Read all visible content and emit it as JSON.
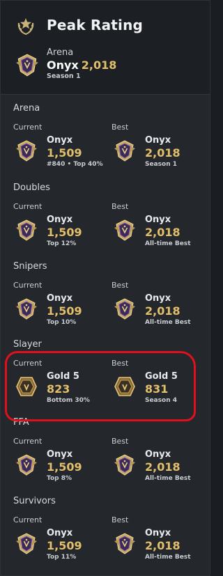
{
  "header": {
    "title": "Peak Rating",
    "icon": "laurel-star-icon",
    "peak": {
      "playlist": "Arena",
      "tier": "Onyx",
      "value": "2,018",
      "season": "Season 1",
      "icon": "onyx-rank-icon"
    }
  },
  "labels": {
    "current": "Current",
    "best": "Best"
  },
  "sections": [
    {
      "title": "Arena",
      "current": {
        "tier": "Onyx",
        "value": "1,509",
        "sub": "#840 • Top 40%",
        "icon": "onyx-rank-icon"
      },
      "best": {
        "tier": "Onyx",
        "value": "2,018",
        "sub": "Season 1",
        "icon": "onyx-rank-icon"
      }
    },
    {
      "title": "Doubles",
      "current": {
        "tier": "Onyx",
        "value": "1,509",
        "sub": "Top 12%",
        "icon": "onyx-rank-icon"
      },
      "best": {
        "tier": "Onyx",
        "value": "2,018",
        "sub": "All-time Best",
        "icon": "onyx-rank-icon"
      }
    },
    {
      "title": "Snipers",
      "current": {
        "tier": "Onyx",
        "value": "1,509",
        "sub": "Top 10%",
        "icon": "onyx-rank-icon"
      },
      "best": {
        "tier": "Onyx",
        "value": "2,018",
        "sub": "All-time Best",
        "icon": "onyx-rank-icon"
      }
    },
    {
      "title": "Slayer",
      "current": {
        "tier": "Gold 5",
        "value": "823",
        "sub": "Bottom 30%",
        "icon": "gold-rank-icon"
      },
      "best": {
        "tier": "Gold 5",
        "value": "831",
        "sub": "Season 4",
        "icon": "gold-rank-icon"
      }
    },
    {
      "title": "FFA",
      "current": {
        "tier": "Onyx",
        "value": "1,509",
        "sub": "Top 8%",
        "icon": "onyx-rank-icon"
      },
      "best": {
        "tier": "Onyx",
        "value": "2,018",
        "sub": "All-time Best",
        "icon": "onyx-rank-icon"
      }
    },
    {
      "title": "Survivors",
      "current": {
        "tier": "Onyx",
        "value": "1,509",
        "sub": "Top 11%",
        "icon": "onyx-rank-icon"
      },
      "best": {
        "tier": "Onyx",
        "value": "2,018",
        "sub": "All-time Best",
        "icon": "onyx-rank-icon"
      }
    }
  ],
  "colors": {
    "accent_gold": "#e2bf6b",
    "highlight_red": "#e0101c",
    "panel_bg": "#24272b",
    "header_bg": "#1c1f23"
  }
}
